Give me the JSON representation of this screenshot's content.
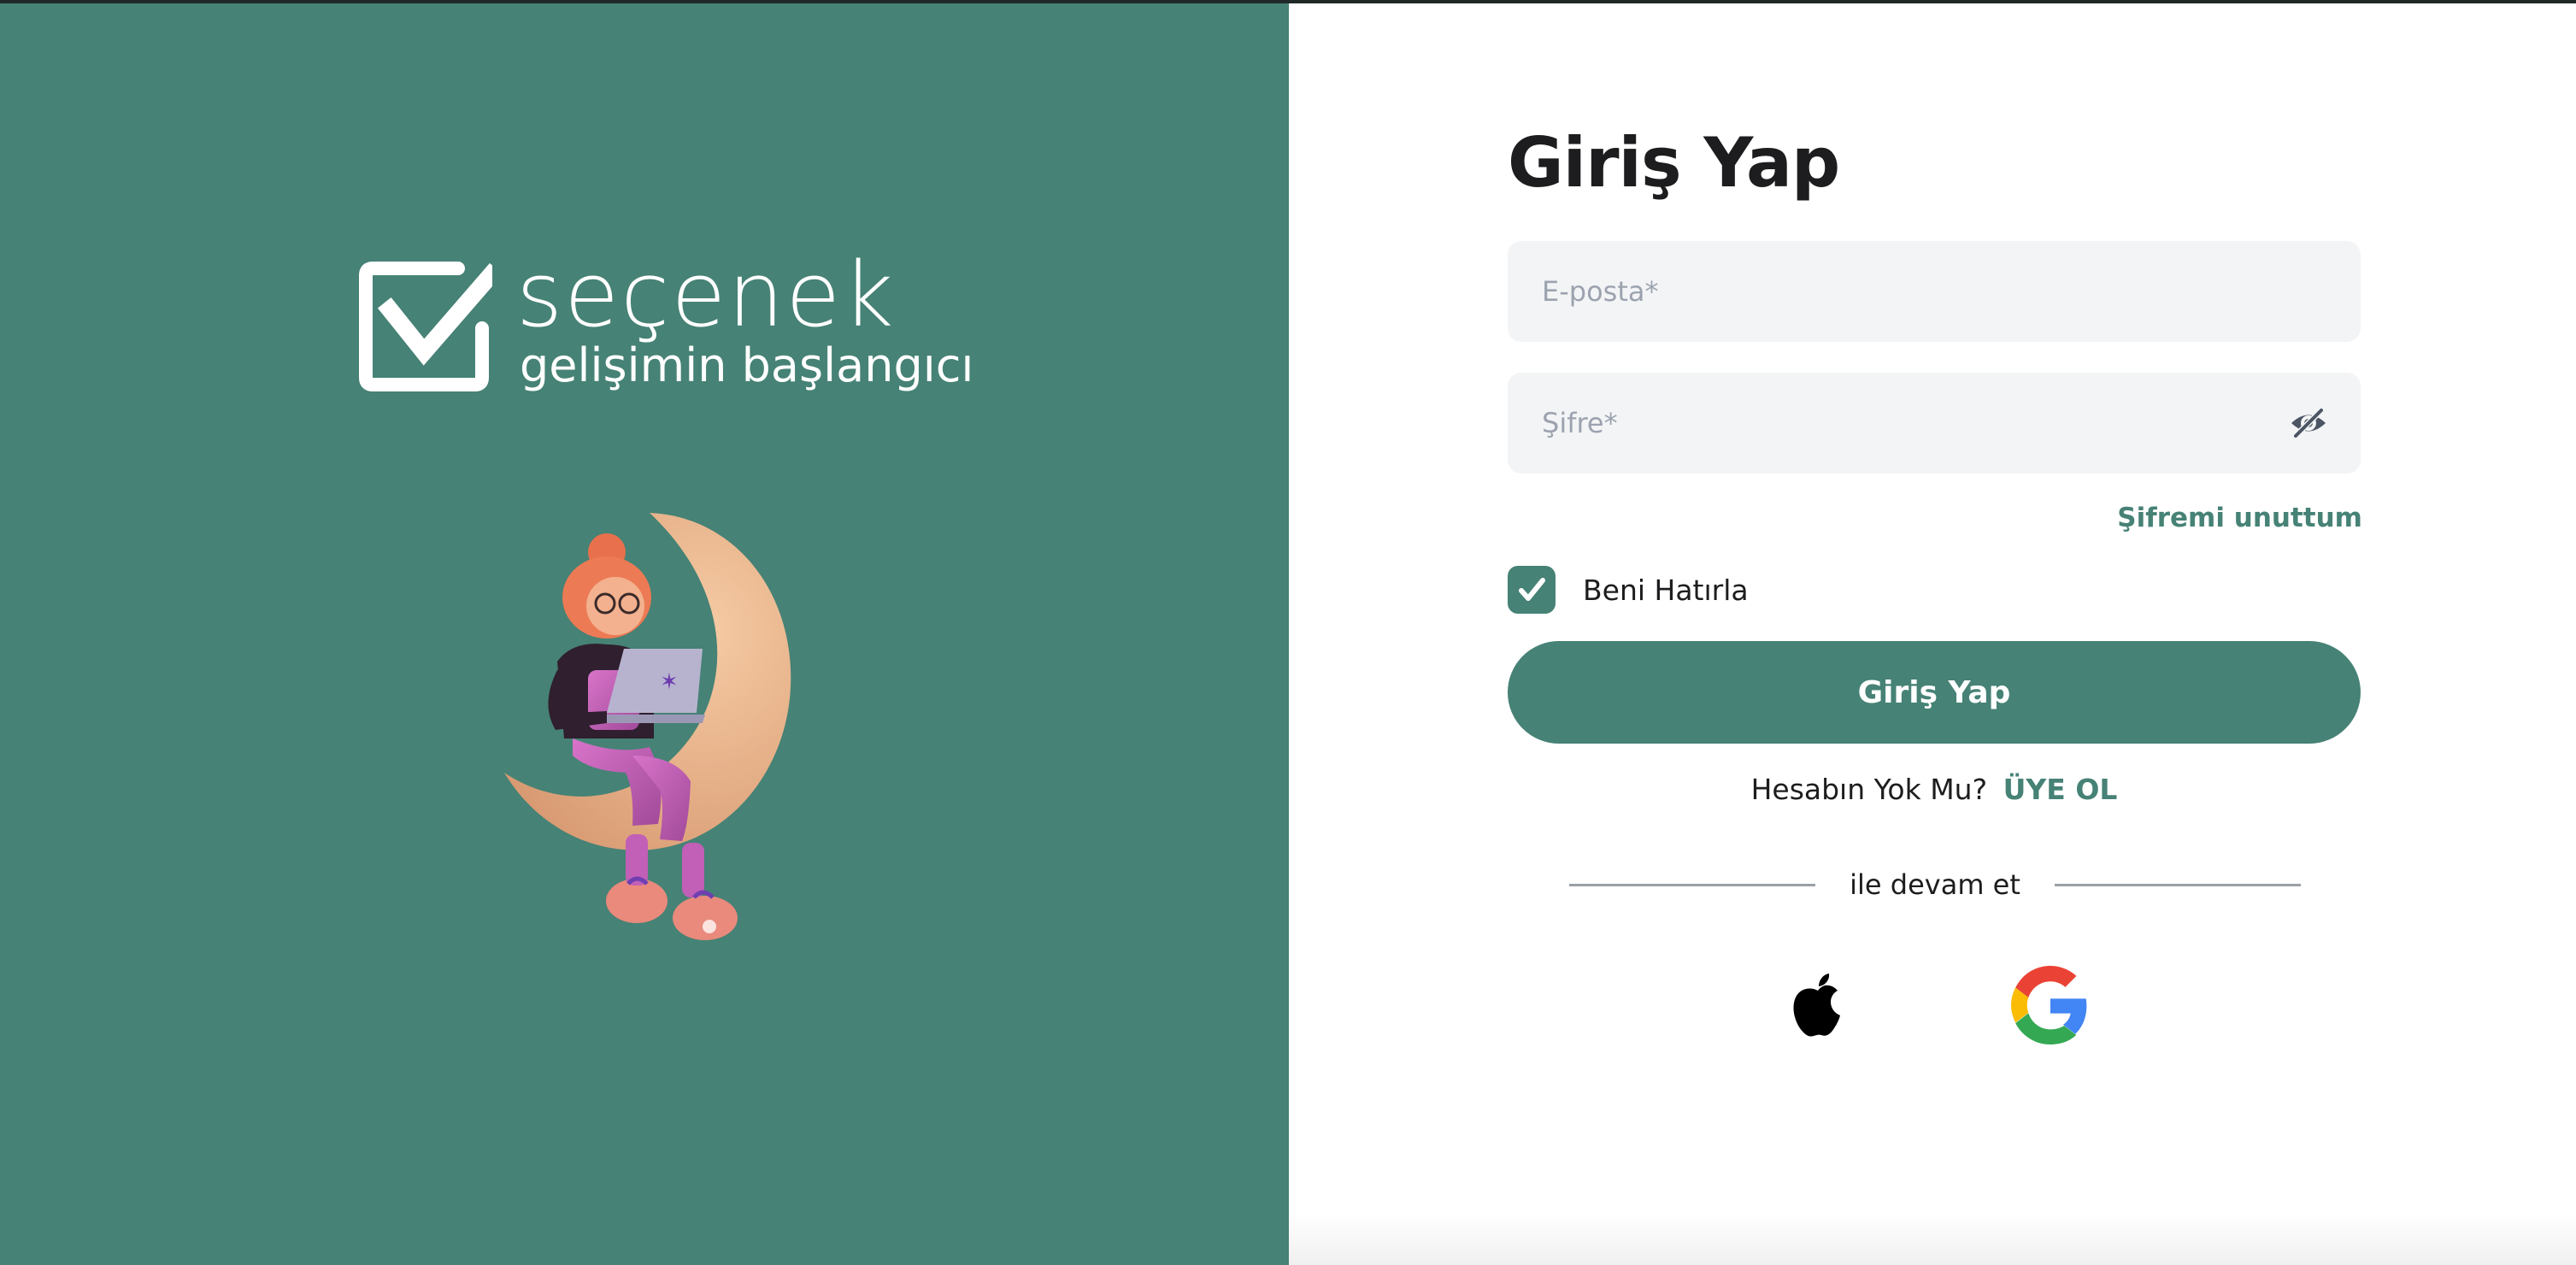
{
  "brand": {
    "wordmark": "seçenek",
    "tagline": "gelişimin başlangıcı"
  },
  "login": {
    "title": "Giriş Yap",
    "email_placeholder": "E-posta*",
    "email_value": "",
    "password_placeholder": "Şifre*",
    "password_value": "",
    "forgot_label": "Şifremi unuttum",
    "remember_label": "Beni Hatırla",
    "remember_checked": true,
    "submit_label": "Giriş Yap",
    "signup_prompt": "Hesabın Yok Mu?",
    "signup_link": "ÜYE OL",
    "divider_text": "ile devam et"
  },
  "social": {
    "providers": [
      "apple-icon",
      "google-icon"
    ]
  },
  "colors": {
    "brand_green": "#468275",
    "field_bg": "#f3f4f6",
    "text_dark": "#1d1d1f"
  }
}
